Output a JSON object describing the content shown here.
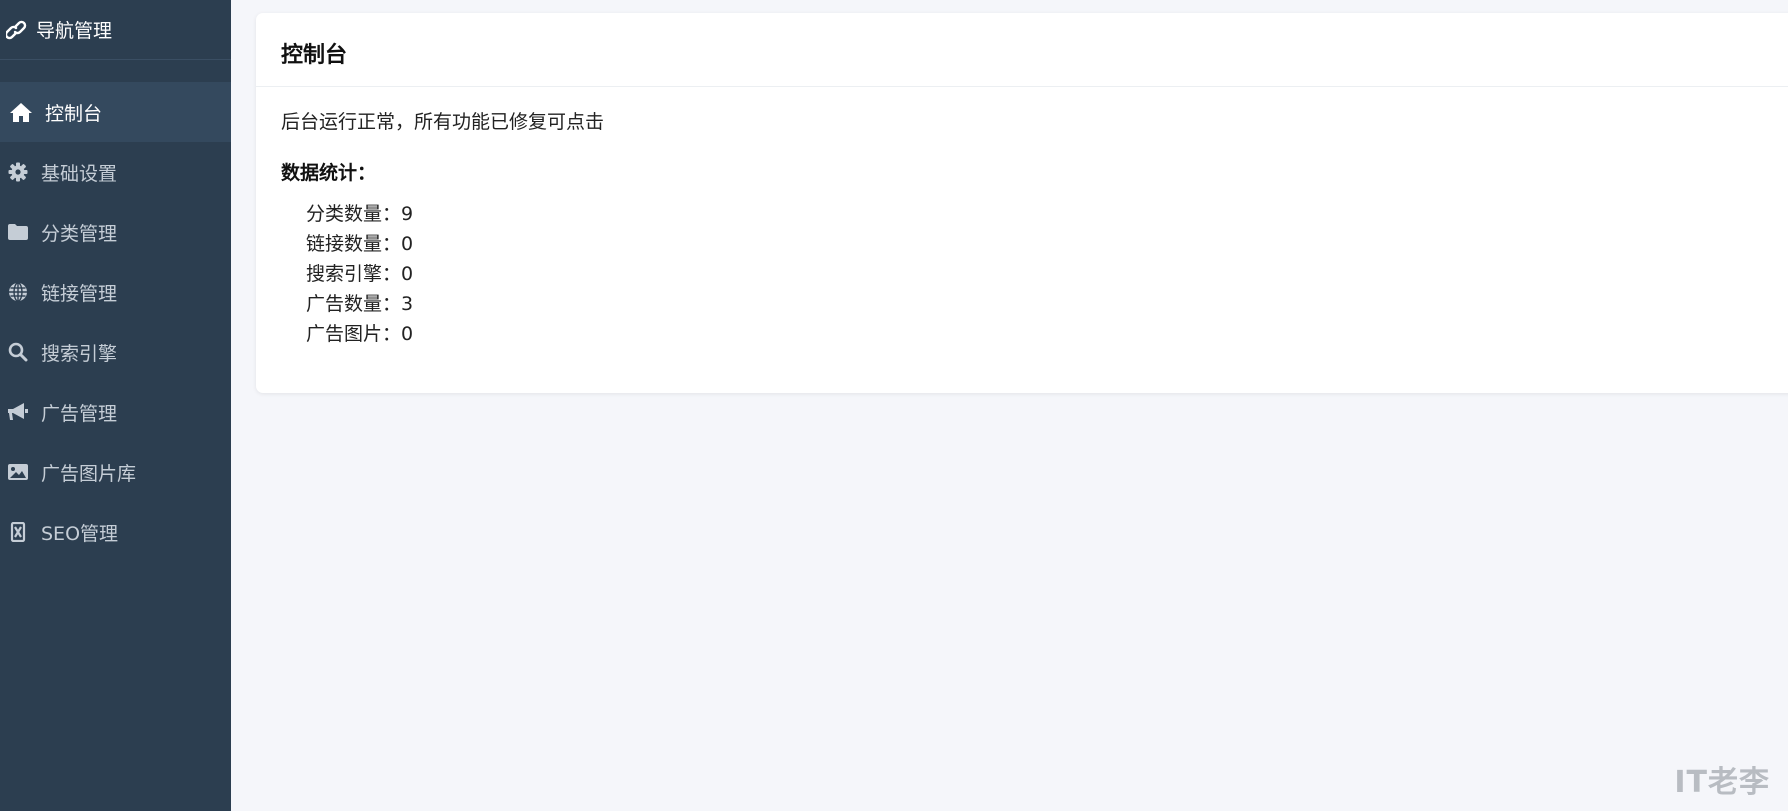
{
  "brand": {
    "title": "导航管理",
    "icon": "link-icon"
  },
  "sidebar": {
    "items": [
      {
        "label": "控制台",
        "icon": "home-icon",
        "active": true
      },
      {
        "label": "基础设置",
        "icon": "gear-icon",
        "active": false
      },
      {
        "label": "分类管理",
        "icon": "folder-icon",
        "active": false
      },
      {
        "label": "链接管理",
        "icon": "globe-icon",
        "active": false
      },
      {
        "label": "搜索引擎",
        "icon": "search-icon",
        "active": false
      },
      {
        "label": "广告管理",
        "icon": "megaphone-icon",
        "active": false
      },
      {
        "label": "广告图片库",
        "icon": "image-icon",
        "active": false
      },
      {
        "label": "SEO管理",
        "icon": "seo-icon",
        "active": false
      }
    ]
  },
  "main": {
    "title": "控制台",
    "status": "后台运行正常，所有功能已修复可点击",
    "stats_heading": "数据统计：",
    "stats": [
      "分类数量：9",
      "链接数量：0",
      "搜索引擎：0",
      "广告数量：3",
      "广告图片：0"
    ]
  },
  "watermark": "IT老李",
  "colors": {
    "sidebar_bg": "#2c3e50",
    "sidebar_active": "#34495e",
    "page_bg": "#f5f6fa"
  }
}
